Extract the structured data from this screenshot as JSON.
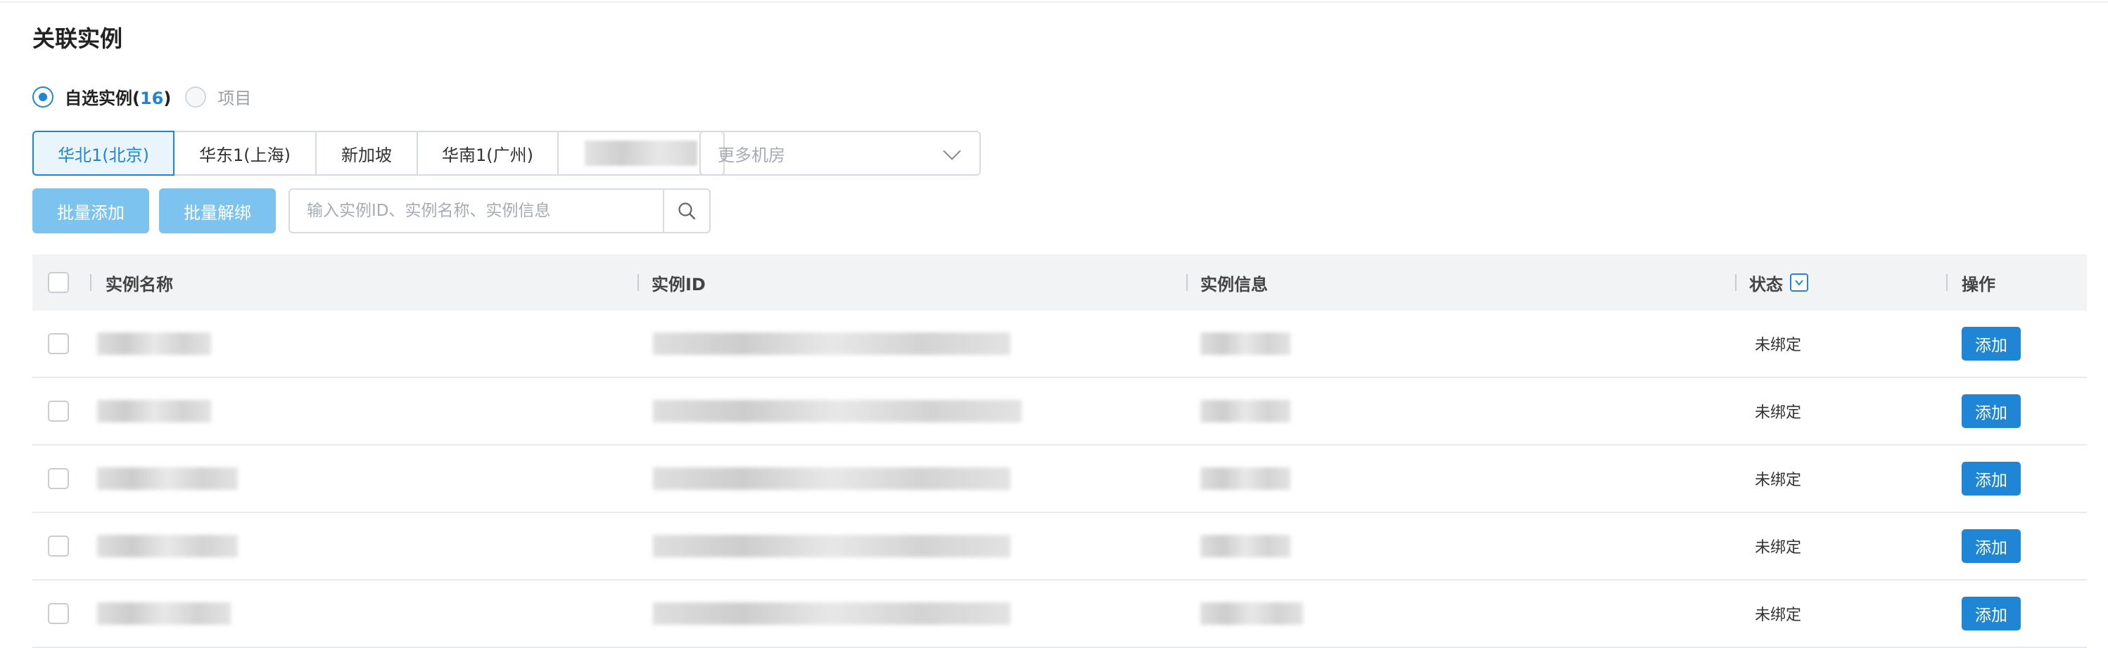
{
  "section_title": "关联实例",
  "selection": {
    "option_custom_label": "自选实例(",
    "option_custom_count": "16",
    "option_custom_suffix": ")",
    "option_project_label": "项目"
  },
  "regions": {
    "tabs": [
      "华北1(北京)",
      "华东1(上海)",
      "新加坡",
      "华南1(广州)"
    ],
    "more_placeholder": "更多机房"
  },
  "toolbar": {
    "batch_add": "批量添加",
    "batch_unbind": "批量解绑",
    "search_placeholder": "输入实例ID、实例名称、实例信息"
  },
  "table": {
    "headers": {
      "name": "实例名称",
      "id": "实例ID",
      "info": "实例信息",
      "status": "状态",
      "action": "操作"
    },
    "rows": [
      {
        "status": "未绑定",
        "action": "添加"
      },
      {
        "status": "未绑定",
        "action": "添加"
      },
      {
        "status": "未绑定",
        "action": "添加"
      },
      {
        "status": "未绑定",
        "action": "添加"
      },
      {
        "status": "未绑定",
        "action": "添加"
      }
    ]
  },
  "colors": {
    "accent": "#1f86d6",
    "button_light": "#7cc4ef",
    "header_bg": "#f2f3f5"
  }
}
